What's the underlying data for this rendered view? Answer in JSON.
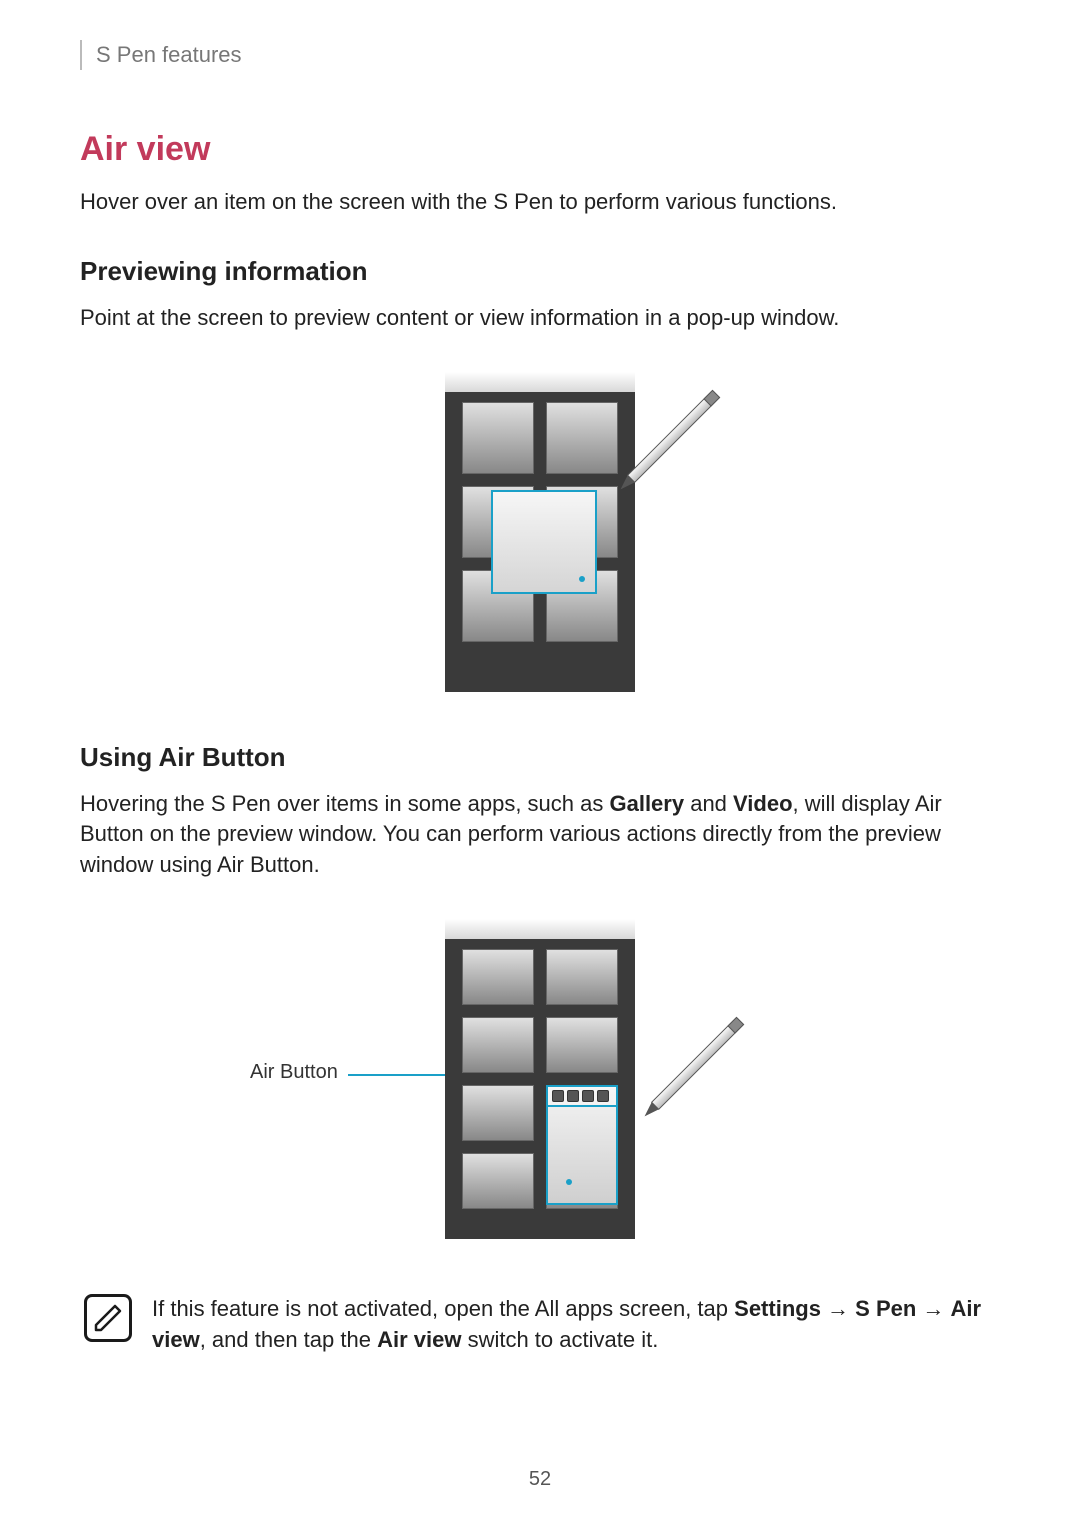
{
  "header": {
    "section": "S Pen features"
  },
  "h1": "Air view",
  "intro": "Hover over an item on the screen with the S Pen to perform various functions.",
  "section1": {
    "heading": "Previewing information",
    "body": "Point at the screen to preview content or view information in a pop-up window."
  },
  "section2": {
    "heading": "Using Air Button",
    "body_pre": "Hovering the S Pen over items in some apps, such as ",
    "body_b1": "Gallery",
    "body_mid1": " and ",
    "body_b2": "Video",
    "body_post": ", will display Air Button on the preview window. You can perform various actions directly from the preview window using Air Button.",
    "callout": "Air Button"
  },
  "note": {
    "pre": "If this feature is not activated, open the All apps screen, tap ",
    "b1": "Settings",
    "arrow1": " → ",
    "b2": "S Pen",
    "arrow2": " → ",
    "b3": "Air view",
    "mid": ", and then tap the ",
    "b4": "Air view",
    "post": " switch to activate it."
  },
  "page_number": "52"
}
